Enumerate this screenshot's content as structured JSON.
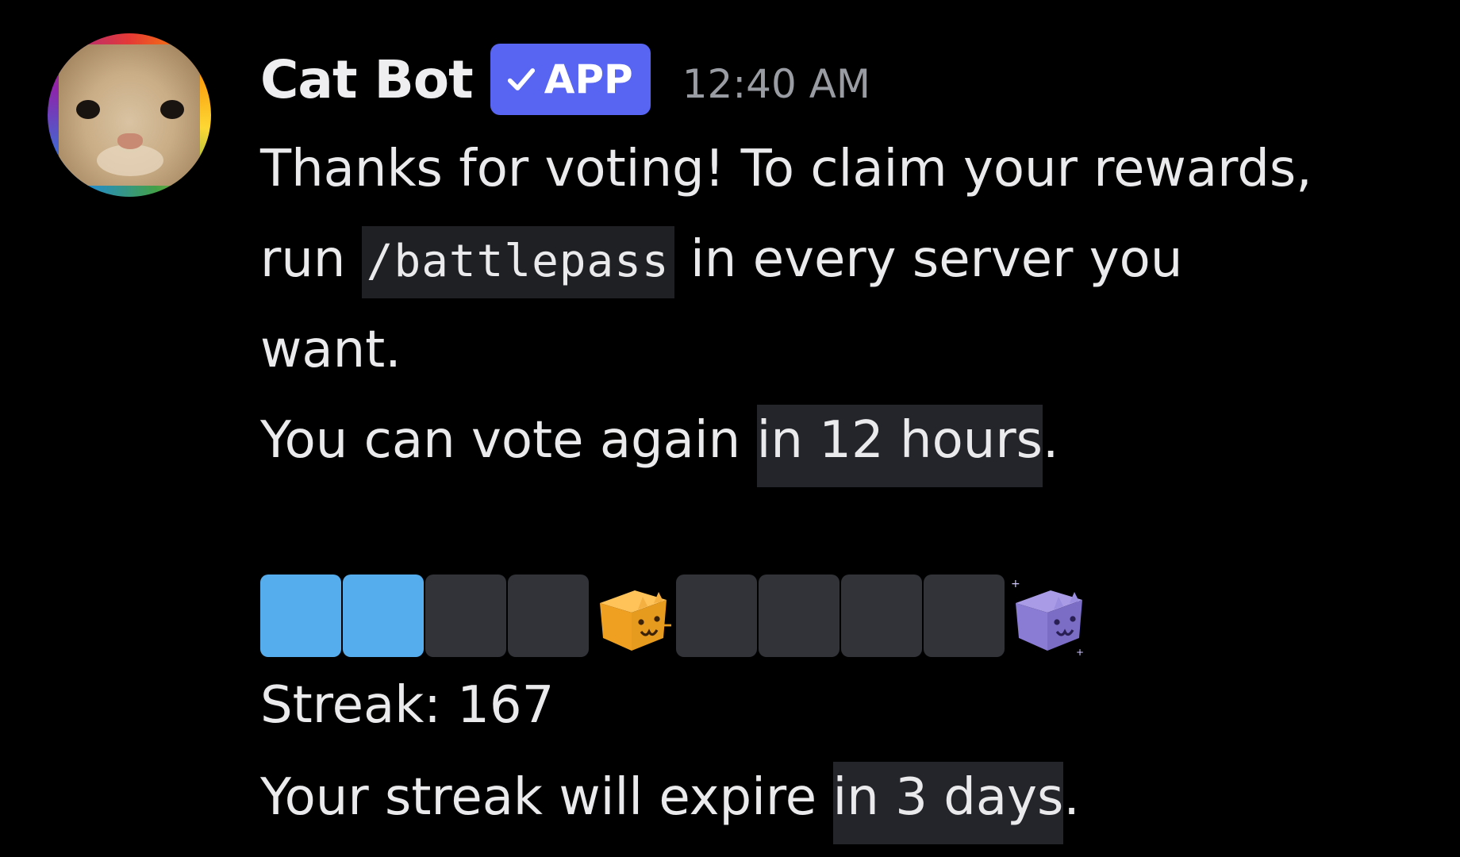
{
  "message": {
    "author": {
      "name": "Cat Bot",
      "badge": "APP",
      "avatar_icon": "cat-avatar-rainbow-ring"
    },
    "timestamp": "12:40 AM",
    "lines": {
      "l1": "Thanks for voting! To claim your rewards,",
      "l2_pre": "run ",
      "l2_code": "/battlepass",
      "l2_post": " in every server you",
      "l3": "want.",
      "l4_pre": "You can vote again ",
      "l4_highlight": "in 12 hours",
      "l4_post": "."
    },
    "progress": {
      "filled_segments": 2,
      "total_segments_before_reward": 4,
      "reward_icons": [
        "gold-cat-box-icon",
        "purple-cat-box-icon"
      ],
      "segments_after_reward": 4
    },
    "streak_label": "Streak: 167",
    "expire": {
      "pre": "Your streak will expire ",
      "highlight": "in 3 days",
      "post": "."
    }
  },
  "colors": {
    "background": "#000000",
    "badge": "#5865f2",
    "progress_filled": "#55aded",
    "progress_empty": "#313338",
    "timestamp": "#9a9ca3"
  }
}
